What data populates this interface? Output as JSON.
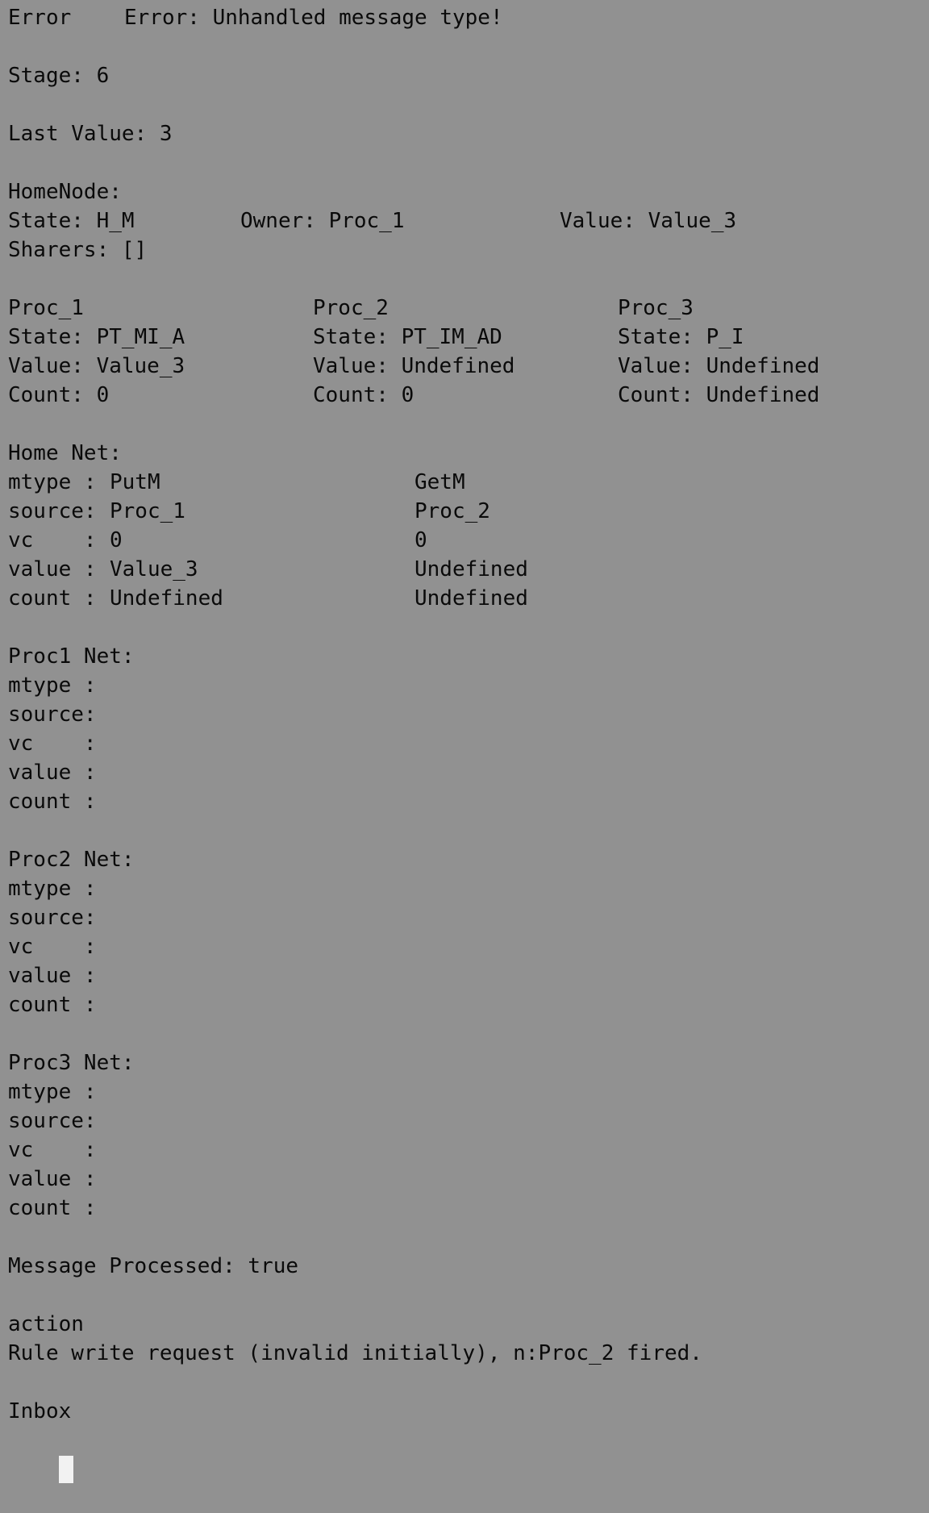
{
  "error": {
    "label": "Error",
    "message": "Error: Unhandled message type!"
  },
  "stage": "Stage: 6",
  "last_value": "Last Value: 3",
  "home_node": {
    "title": "HomeNode:",
    "state": "State: H_M",
    "owner": "Owner: Proc_1",
    "value": "Value: Value_3",
    "sharers": "Sharers: []"
  },
  "procs": [
    {
      "name": "Proc_1",
      "state": "State: PT_MI_A",
      "value": "Value: Value_3",
      "count": "Count: 0"
    },
    {
      "name": "Proc_2",
      "state": "State: PT_IM_AD",
      "value": "Value: Undefined",
      "count": "Count: 0"
    },
    {
      "name": "Proc_3",
      "state": "State: P_I",
      "value": "Value: Undefined",
      "count": "Count: Undefined"
    }
  ],
  "home_net": {
    "title": "Home Net:",
    "rows": [
      {
        "label": "mtype :",
        "v1": "PutM",
        "v2": "GetM"
      },
      {
        "label": "source:",
        "v1": "Proc_1",
        "v2": "Proc_2"
      },
      {
        "label": "vc    :",
        "v1": "0",
        "v2": "0"
      },
      {
        "label": "value :",
        "v1": "Value_3",
        "v2": "Undefined"
      },
      {
        "label": "count :",
        "v1": "Undefined",
        "v2": "Undefined"
      }
    ]
  },
  "proc1_net": {
    "title": "Proc1 Net:",
    "rows": [
      "mtype :",
      "source:",
      "vc    :",
      "value :",
      "count :"
    ]
  },
  "proc2_net": {
    "title": "Proc2 Net:",
    "rows": [
      "mtype :",
      "source:",
      "vc    :",
      "value :",
      "count :"
    ]
  },
  "proc3_net": {
    "title": "Proc3 Net:",
    "rows": [
      "mtype :",
      "source:",
      "vc    :",
      "value :",
      "count :"
    ]
  },
  "message_processed": "Message Processed: true",
  "action": {
    "title": "action",
    "text": "Rule write request (invalid initially), n:Proc_2 fired."
  },
  "inbox": {
    "title": "Inbox"
  }
}
